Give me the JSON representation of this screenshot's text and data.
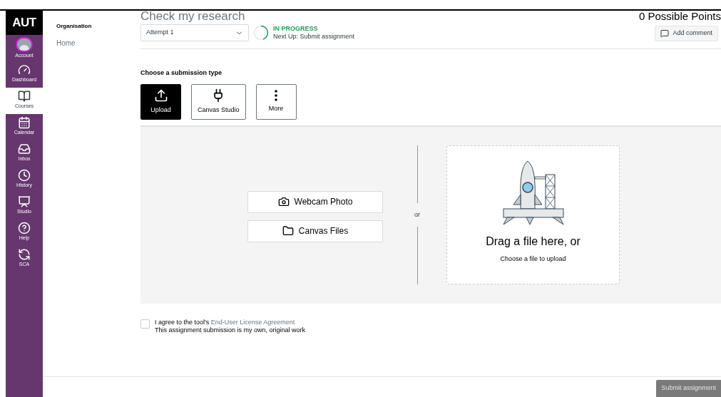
{
  "global_nav": {
    "logo": "AUT",
    "items": [
      {
        "kind": "account",
        "label": "Account",
        "selected": false
      },
      {
        "kind": "dashboard",
        "label": "Dashboard",
        "selected": false
      },
      {
        "kind": "courses",
        "label": "Courses",
        "selected": true
      },
      {
        "kind": "calendar",
        "label": "Calendar",
        "selected": false
      },
      {
        "kind": "inbox",
        "label": "Inbox",
        "selected": false
      },
      {
        "kind": "history",
        "label": "History",
        "selected": false
      },
      {
        "kind": "studio",
        "label": "Studio",
        "selected": false
      },
      {
        "kind": "help",
        "label": "Help",
        "selected": false
      },
      {
        "kind": "sca",
        "label": "SCA",
        "selected": false
      }
    ]
  },
  "course_nav": {
    "heading": "Organisation",
    "items": [
      {
        "label": "Home"
      }
    ]
  },
  "assignment": {
    "title": "Check my research",
    "points": "0 Possible Points",
    "attempt": "Attempt 1",
    "status": "IN PROGRESS",
    "next_up": "Next Up: Submit assignment",
    "add_comment": "Add comment"
  },
  "submission_types": {
    "heading": "Choose a submission type",
    "items": [
      {
        "kind": "upload",
        "label": "Upload",
        "selected": true
      },
      {
        "kind": "studio",
        "label": "Canvas Studio",
        "selected": false
      },
      {
        "kind": "more",
        "label": "More",
        "selected": false
      }
    ]
  },
  "upload": {
    "buttons": [
      {
        "kind": "webcam",
        "label": "Webcam Photo"
      },
      {
        "kind": "files",
        "label": "Canvas Files"
      }
    ],
    "separator": "or",
    "dropzone_title": "Drag a file here, or",
    "dropzone_hint": "Choose a file to upload"
  },
  "agreement": {
    "checked": false,
    "text": "I agree to the tool's",
    "link": "End-User License Agreement",
    "note": "This assignment submission is my own, original work"
  },
  "footer": {
    "submit": "Submit assignment",
    "disabled": true
  }
}
